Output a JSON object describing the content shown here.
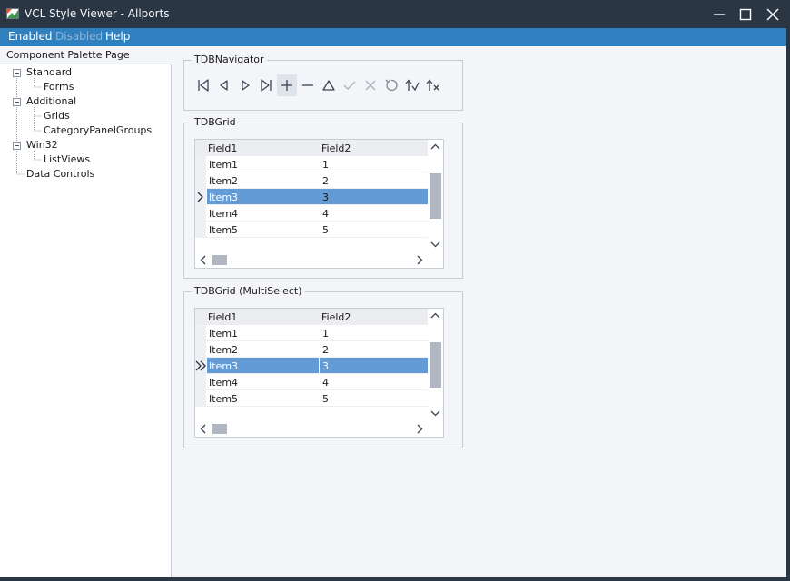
{
  "window": {
    "title": "VCL Style Viewer - Allports"
  },
  "menu": {
    "items": [
      "Enabled",
      "Disabled",
      "Help"
    ]
  },
  "colors": {
    "menu_enabled": "#ffffff",
    "menu_disabled": "#8fb4d8",
    "selection": "#629bd6"
  },
  "tree": {
    "header": "Component Palette Page",
    "nodes": [
      {
        "label": "Standard",
        "children": [
          "Forms"
        ]
      },
      {
        "label": "Additional",
        "children": [
          "Grids",
          "CategoryPanelGroups"
        ]
      },
      {
        "label": "Win32",
        "children": [
          "ListViews"
        ]
      },
      {
        "label": "Data Controls",
        "children": []
      }
    ]
  },
  "navigator": {
    "title": "TDBNavigator",
    "buttons": [
      "first-icon",
      "prior-icon",
      "next-icon",
      "last-icon",
      "insert-icon",
      "delete-icon",
      "edit-icon",
      "post-icon",
      "cancel-icon",
      "refresh-icon",
      "apply-updates-icon",
      "cancel-updates-icon"
    ],
    "hovered": "insert-icon"
  },
  "grid": {
    "title": "TDBGrid",
    "columns": [
      "Field1",
      "Field2"
    ],
    "rows": [
      [
        "Item1",
        "1"
      ],
      [
        "Item2",
        "2"
      ],
      [
        "Item3",
        "3"
      ],
      [
        "Item4",
        "4"
      ],
      [
        "Item5",
        "5"
      ]
    ],
    "selected_row": 2,
    "indicator": "current-row-arrow-icon"
  },
  "grid_multi": {
    "title": "TDBGrid (MultiSelect)",
    "columns": [
      "Field1",
      "Field2"
    ],
    "rows": [
      [
        "Item1",
        "1"
      ],
      [
        "Item2",
        "2"
      ],
      [
        "Item3",
        "3"
      ],
      [
        "Item4",
        "4"
      ],
      [
        "Item5",
        "5"
      ]
    ],
    "selected_row": 2,
    "indicator": "multiselect-arrow-icon"
  }
}
